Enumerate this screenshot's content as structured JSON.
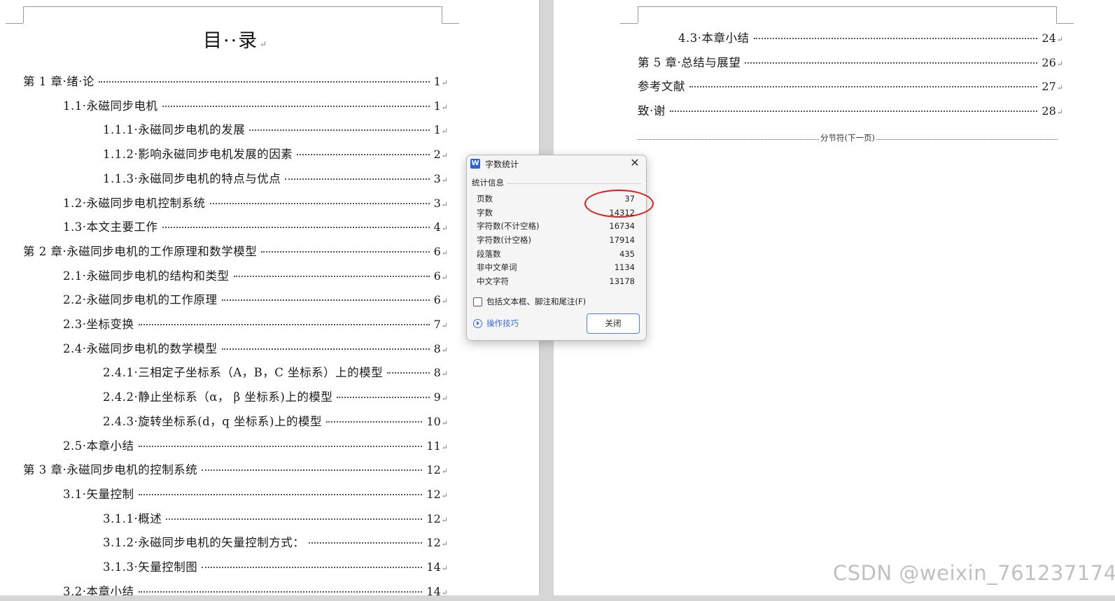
{
  "left_page": {
    "title": "目··录",
    "para_mark": "↵",
    "entries": [
      {
        "title": "第 1 章·绪·论",
        "page": "1"
      },
      {
        "title": "1.1·永磁同步电机",
        "page": "1"
      },
      {
        "title": "1.1.1·永磁同步电机的发展",
        "page": "1"
      },
      {
        "title": "1.1.2·影响永磁同步电机发展的因素",
        "page": "2"
      },
      {
        "title": "1.1.3·永磁同步电机的特点与优点",
        "page": "3"
      },
      {
        "title": "1.2·永磁同步电机控制系统",
        "page": "3"
      },
      {
        "title": "1.3·本文主要工作",
        "page": "4"
      },
      {
        "title": "第 2 章·永磁同步电机的工作原理和数学模型",
        "page": "6"
      },
      {
        "title": "2.1·永磁同步电机的结构和类型",
        "page": "6"
      },
      {
        "title": "2.2·永磁同步电机的工作原理",
        "page": "6"
      },
      {
        "title": "2.3·坐标变换",
        "page": "7"
      },
      {
        "title": "2.4·永磁同步电机的数学模型",
        "page": "8"
      },
      {
        "title": "2.4.1·三相定子坐标系（A，B，C 坐标系）上的模型",
        "page": "8"
      },
      {
        "title": "2.4.2·静止坐标系（α， β 坐标系)上的模型",
        "page": "9"
      },
      {
        "title": "2.4.3·旋转坐标系(d，q 坐标系)上的模型",
        "page": "10"
      },
      {
        "title": "2.5·本章小结",
        "page": "11"
      },
      {
        "title": "第 3 章·永磁同步电机的控制系统",
        "page": "12"
      },
      {
        "title": "3.1·矢量控制",
        "page": "12"
      },
      {
        "title": "3.1.1·概述",
        "page": "12"
      },
      {
        "title": "3.1.2·永磁同步电机的矢量控制方式：",
        "page": "12"
      },
      {
        "title": "3.1.3·矢量控制图",
        "page": "14"
      },
      {
        "title": "3.2·本章小结",
        "page": "14"
      }
    ]
  },
  "right_page": {
    "entries": [
      {
        "title": "4.3·本章小结",
        "page": "24"
      },
      {
        "title": "第 5 章·总结与展望",
        "page": "26"
      },
      {
        "title": "参考文献",
        "page": "27"
      },
      {
        "title": "致·谢",
        "page": "28"
      }
    ],
    "section_break_label": "分节符(下一页)"
  },
  "dialog": {
    "title": "字数统计",
    "app_icon": "W",
    "close_glyph": "✕",
    "group_label": "统计信息",
    "stats": [
      {
        "label": "页数",
        "value": "37"
      },
      {
        "label": "字数",
        "value": "14312"
      },
      {
        "label": "字符数(不计空格)",
        "value": "16734"
      },
      {
        "label": "字符数(计空格)",
        "value": "17914"
      },
      {
        "label": "段落数",
        "value": "435"
      },
      {
        "label": "非中文单词",
        "value": "1134"
      },
      {
        "label": "中文字符",
        "value": "13178"
      }
    ],
    "checkbox_label": "包括文本框、脚注和尾注(F)",
    "tips_label": "操作技巧",
    "close_button_label": "关闭"
  },
  "watermark": "CSDN @weixin_761237174"
}
